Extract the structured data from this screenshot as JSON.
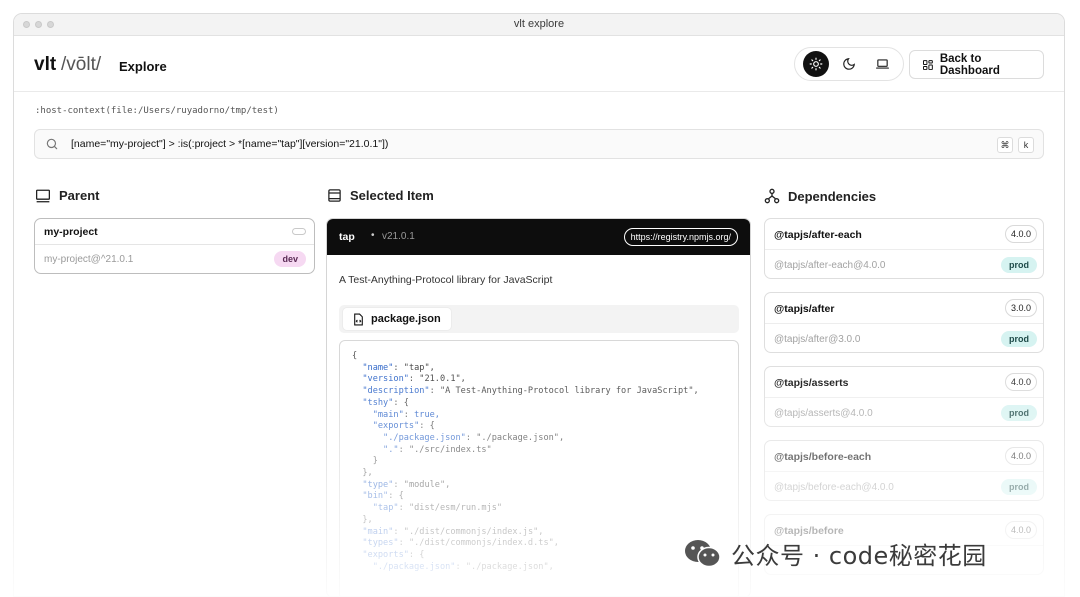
{
  "window": {
    "title": "vlt explore"
  },
  "header": {
    "logo": "vlt",
    "logo_pronunciation": "/vōlt/",
    "nav_label": "Explore",
    "back_button": "Back to Dashboard",
    "theme_options": [
      {
        "icon": "sun-icon",
        "active": true
      },
      {
        "icon": "moon-icon",
        "active": false
      },
      {
        "icon": "laptop-icon",
        "active": false
      }
    ]
  },
  "host_context": ":host-context(file:/Users/ruyadorno/tmp/test)",
  "search": {
    "value": "[name=\"my-project\"] > :is(:project > *[name=\"tap\"][version=\"21.0.1\"])",
    "shortcut": [
      "⌘",
      "k"
    ]
  },
  "parent": {
    "title": "Parent",
    "card": {
      "name": "my-project",
      "spec": "my-project@^21.0.1",
      "badge": "dev"
    }
  },
  "selected": {
    "title": "Selected Item",
    "name": "tap",
    "dot": "•",
    "version": "v21.0.1",
    "registry": "https://registry.npmjs.org/",
    "description": "A Test-Anything-Protocol library for JavaScript",
    "tab": "package.json"
  },
  "dependencies": {
    "title": "Dependencies",
    "items": [
      {
        "name": "@tapjs/after-each",
        "version": "4.0.0",
        "spec": "@tapjs/after-each@4.0.0",
        "badge": "prod"
      },
      {
        "name": "@tapjs/after",
        "version": "3.0.0",
        "spec": "@tapjs/after@3.0.0",
        "badge": "prod"
      },
      {
        "name": "@tapjs/asserts",
        "version": "4.0.0",
        "spec": "@tapjs/asserts@4.0.0",
        "badge": "prod"
      },
      {
        "name": "@tapjs/before-each",
        "version": "4.0.0",
        "spec": "@tapjs/before-each@4.0.0",
        "badge": "prod"
      },
      {
        "name": "@tapjs/before",
        "version": "4.0.0",
        "spec": "",
        "badge": ""
      }
    ]
  },
  "code": [
    {
      "t": "p",
      "v": "{"
    },
    {
      "t": "kv",
      "k": "  \"name\"",
      "v": "\"tap\","
    },
    {
      "t": "kv",
      "k": "  \"version\"",
      "v": "\"21.0.1\","
    },
    {
      "t": "kv",
      "k": "  \"description\"",
      "v": "\"A Test-Anything-Protocol library for JavaScript\","
    },
    {
      "t": "kv",
      "k": "  \"tshy\"",
      "v": "{"
    },
    {
      "t": "kv",
      "k": "    \"main\"",
      "v": "true,",
      "b": true
    },
    {
      "t": "kv",
      "k": "    \"exports\"",
      "v": "{"
    },
    {
      "t": "kv",
      "k": "      \"./package.json\"",
      "v": "\"./package.json\","
    },
    {
      "t": "kv",
      "k": "      \".\"",
      "v": "\"./src/index.ts\""
    },
    {
      "t": "p",
      "v": "    }"
    },
    {
      "t": "p",
      "v": "  },"
    },
    {
      "t": "kv",
      "k": "  \"type\"",
      "v": "\"module\","
    },
    {
      "t": "kv",
      "k": "  \"bin\"",
      "v": "{"
    },
    {
      "t": "kv",
      "k": "    \"tap\"",
      "v": "\"dist/esm/run.mjs\""
    },
    {
      "t": "p",
      "v": "  },"
    },
    {
      "t": "kv",
      "k": "  \"main\"",
      "v": "\"./dist/commonjs/index.js\","
    },
    {
      "t": "kv",
      "k": "  \"types\"",
      "v": "\"./dist/commonjs/index.d.ts\","
    },
    {
      "t": "kv",
      "k": "  \"exports\"",
      "v": "{"
    },
    {
      "t": "kv",
      "k": "    \"./package.json\"",
      "v": "\"./package.json\","
    }
  ],
  "watermark": "公众号 · code秘密花园"
}
